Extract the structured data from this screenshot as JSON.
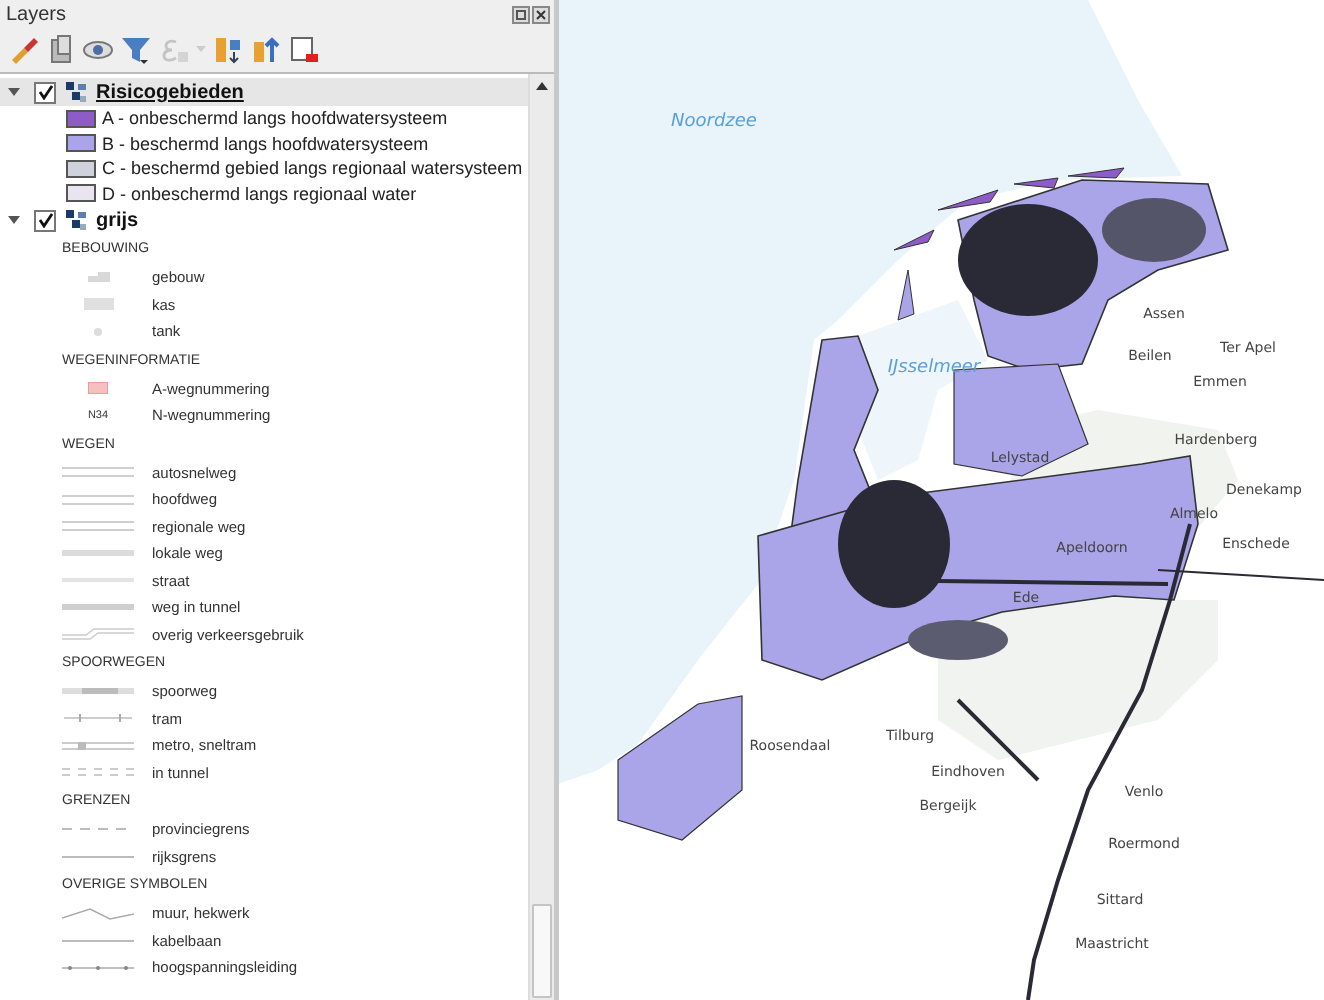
{
  "panel": {
    "title": "Layers"
  },
  "layers": [
    {
      "name": "Risicogebieden",
      "checked": true,
      "expanded": true,
      "selected": true,
      "legend": [
        {
          "kind": "swatch",
          "label": "A - onbeschermd langs hoofdwatersysteem",
          "color": "#8e5cc6"
        },
        {
          "kind": "swatch",
          "label": "B - beschermd langs hoofdwatersysteem",
          "color": "#a9a5e8"
        },
        {
          "kind": "swatch",
          "label": "C - beschermd gebied langs regionaal watersysteem",
          "color": "#cfd1dc"
        },
        {
          "kind": "swatch",
          "label": "D - onbeschermd langs regionaal water",
          "color": "#e9e4f2"
        }
      ]
    },
    {
      "name": "grijs",
      "checked": true,
      "expanded": true,
      "selected": false,
      "legend": [
        {
          "kind": "heading",
          "label": "BEBOUWING"
        },
        {
          "kind": "building",
          "label": "gebouw"
        },
        {
          "kind": "block",
          "label": "kas"
        },
        {
          "kind": "dot",
          "label": "tank"
        },
        {
          "kind": "heading",
          "label": "WEGENINFORMATIE"
        },
        {
          "kind": "plate",
          "label": "A-wegnummering"
        },
        {
          "kind": "badge",
          "badge": "N34",
          "label": "N-wegnummering"
        },
        {
          "kind": "heading",
          "label": "WEGEN"
        },
        {
          "kind": "double",
          "label": "autosnelweg"
        },
        {
          "kind": "double",
          "label": "hoofdweg"
        },
        {
          "kind": "double",
          "label": "regionale weg"
        },
        {
          "kind": "single",
          "label": "lokale weg"
        },
        {
          "kind": "thin",
          "label": "straat"
        },
        {
          "kind": "thick",
          "label": "weg in tunnel"
        },
        {
          "kind": "outline",
          "label": "overig verkeersgebruik"
        },
        {
          "kind": "heading",
          "label": "SPOORWEGEN"
        },
        {
          "kind": "rail",
          "label": "spoorweg"
        },
        {
          "kind": "tram",
          "label": "tram"
        },
        {
          "kind": "metro",
          "label": "metro, sneltram"
        },
        {
          "kind": "tunnel",
          "label": "in tunnel"
        },
        {
          "kind": "heading",
          "label": "GRENZEN"
        },
        {
          "kind": "dashed",
          "label": "provinciegrens"
        },
        {
          "kind": "line",
          "label": "rijksgrens"
        },
        {
          "kind": "heading",
          "label": "OVERIGE SYMBOLEN"
        },
        {
          "kind": "wall",
          "label": "muur, hekwerk"
        },
        {
          "kind": "line",
          "label": "kabelbaan"
        },
        {
          "kind": "power",
          "label": "hoogspanningsleiding"
        }
      ]
    }
  ],
  "map": {
    "labels": [
      {
        "text": "Noordzee",
        "kind": "water"
      },
      {
        "text": "IJsselmeer",
        "kind": "water"
      },
      {
        "text": "Assen",
        "kind": "place"
      },
      {
        "text": "Beilen",
        "kind": "place"
      },
      {
        "text": "Ter Apel",
        "kind": "place"
      },
      {
        "text": "Emmen",
        "kind": "place"
      },
      {
        "text": "Lelystad",
        "kind": "place"
      },
      {
        "text": "Hardenberg",
        "kind": "place"
      },
      {
        "text": "Denekamp",
        "kind": "place"
      },
      {
        "text": "Almelo",
        "kind": "place"
      },
      {
        "text": "Enschede",
        "kind": "place"
      },
      {
        "text": "Apeldoorn",
        "kind": "place"
      },
      {
        "text": "Ede",
        "kind": "place"
      },
      {
        "text": "Roosendaal",
        "kind": "place"
      },
      {
        "text": "Tilburg",
        "kind": "place"
      },
      {
        "text": "Eindhoven",
        "kind": "place"
      },
      {
        "text": "Bergeijk",
        "kind": "place"
      },
      {
        "text": "Venlo",
        "kind": "place"
      },
      {
        "text": "Roermond",
        "kind": "place"
      },
      {
        "text": "Sittard",
        "kind": "place"
      },
      {
        "text": "Maastricht",
        "kind": "place"
      }
    ]
  }
}
